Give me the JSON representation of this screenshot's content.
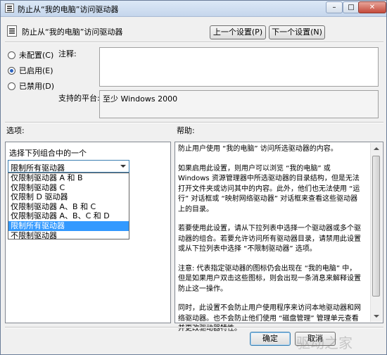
{
  "window": {
    "title": "防止从“我的电脑”访问驱动器",
    "min_glyph": "–",
    "max_glyph": "□",
    "close_glyph": "✕"
  },
  "header": {
    "policy_name": "防止从“我的电脑”访问驱动器",
    "prev_button": "上一个设置(P)",
    "next_button": "下一个设置(N)"
  },
  "state": {
    "options": [
      {
        "label": "未配置(C)",
        "checked": false
      },
      {
        "label": "已启用(E)",
        "checked": true
      },
      {
        "label": "已禁用(D)",
        "checked": false
      }
    ]
  },
  "comment": {
    "label": "注释:",
    "value": ""
  },
  "platform": {
    "label": "支持的平台:",
    "value": "至少 Windows 2000"
  },
  "options_section": {
    "label": "选项:",
    "prompt": "选择下列组合中的一个",
    "selected": "限制所有驱动器",
    "items": [
      "仅限制驱动器 A 和 B",
      "仅限制驱动器 C",
      "仅限制 D 驱动器",
      "仅限制驱动器 A、B 和 C",
      "仅限制驱动器 A、B、C 和 D",
      "限制所有驱动器",
      "不限制驱动器"
    ],
    "selected_index": 5
  },
  "help_section": {
    "label": "帮助:",
    "paragraphs": [
      "防止用户使用 “我的电脑” 访问所选驱动器的内容。",
      "如果启用此设置，则用户可以浏览 “我的电脑” 或 Windows 资源管理器中所选驱动器的目录结构，但是无法打开文件夹或访问其中的内容。此外，他们也无法使用 “运行” 对话框或 “映射网络驱动器” 对话框来查看这些驱动器上的目录。",
      "若要使用此设置，请从下拉列表中选择一个驱动器或多个驱动器的组合。若要允许访问所有驱动器目录，请禁用此设置或从下拉列表中选择 “不限制驱动器” 选项。",
      "注意: 代表指定驱动器的图标仍会出现在 “我的电脑” 中，但是如果用户双击这些图标，则会出现一条消息来解释设置防止这一操作。",
      "同时，此设置不会防止用户使用程序来访问本地驱动器和网络驱动器。也不会防止他们使用 “磁盘管理” 管理单元查看并更改驱动器特性。"
    ]
  },
  "footer": {
    "ok_button": "确定",
    "cancel_button": "取消"
  },
  "watermark": "驱动之家"
}
